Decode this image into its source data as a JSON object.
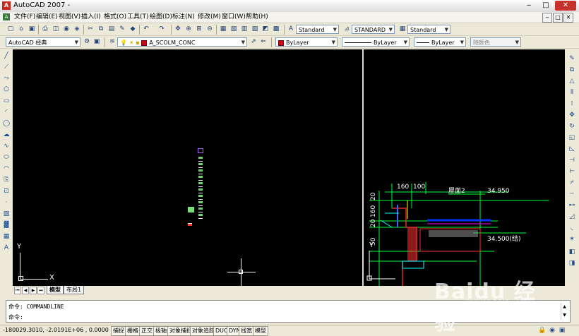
{
  "window": {
    "title": "AutoCAD 2007 -",
    "app_icon": "A",
    "minimize": "‒",
    "maximize": "□",
    "close": "✕"
  },
  "menu": [
    "文件(F)",
    "编辑(E)",
    "视图(V)",
    "插入(I)",
    "格式(O)",
    "工具(T)",
    "绘图(D)",
    "标注(N)",
    "修改(M)",
    "窗口(W)",
    "帮助(H)"
  ],
  "mdi_controls": [
    "‒",
    "□",
    "✕"
  ],
  "styles_toolbar": {
    "text_style": "Standard",
    "dim_style": "STANDARD",
    "table_style": "Standard"
  },
  "workspace": {
    "name": "AutoCAD 经典"
  },
  "layer": {
    "name": "A_SCOLM_CONC",
    "color": "#d0001a"
  },
  "properties": {
    "color": "ByLayer",
    "linetype": "ByLayer",
    "lineweight": "ByLayer",
    "plot_style": "随颜色"
  },
  "tabs": {
    "model": "模型",
    "layout1": "布局1"
  },
  "command": {
    "line1": "命令: COMMANDLINE",
    "line2": "命令:"
  },
  "status": {
    "coords": "-180029.3010, -2.0191E+06 , 0.0000",
    "buttons": [
      "捕捉",
      "栅格",
      "正交",
      "极轴",
      "对象捕捉",
      "对象追踪",
      "DUCS",
      "DYN",
      "线宽",
      "模型"
    ]
  },
  "drawing": {
    "ucs_x": "X",
    "ucs_y": "Y",
    "dims": {
      "d160": "160",
      "d100": "100",
      "d20": "20",
      "d160v": "160",
      "d20v": "20",
      "d50": "50"
    },
    "labels": {
      "roof": "屋面2",
      "elev_top": "34.950",
      "elev_bottom": "34.500(结)"
    }
  },
  "watermark": {
    "brand": "Baidu 经验",
    "url": "jingyan.baidu.com"
  }
}
